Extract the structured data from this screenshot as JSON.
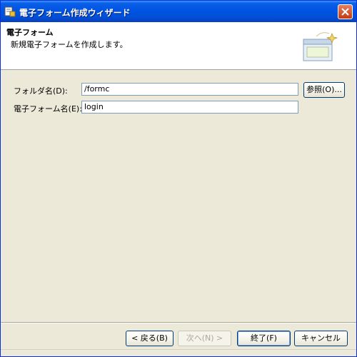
{
  "window": {
    "title": "電子フォーム作成ウィザード"
  },
  "banner": {
    "title": "電子フォーム",
    "description": "新規電子フォームを作成します。"
  },
  "form": {
    "folder_label": "フォルダ名(D):",
    "folder_value": "/formc",
    "browse_label": "参照(O)...",
    "form_name_label": "電子フォーム名(E):",
    "form_name_value": "login"
  },
  "footer": {
    "back_label": "< 戻る(B)",
    "next_label": "次へ(N) >",
    "finish_label": "終了(F)",
    "cancel_label": "キャンセル"
  },
  "colors": {
    "titlebar": "#0054e3",
    "window_bg": "#ece9d8",
    "banner_bg": "#ffffff",
    "close_button": "#c23b14"
  }
}
